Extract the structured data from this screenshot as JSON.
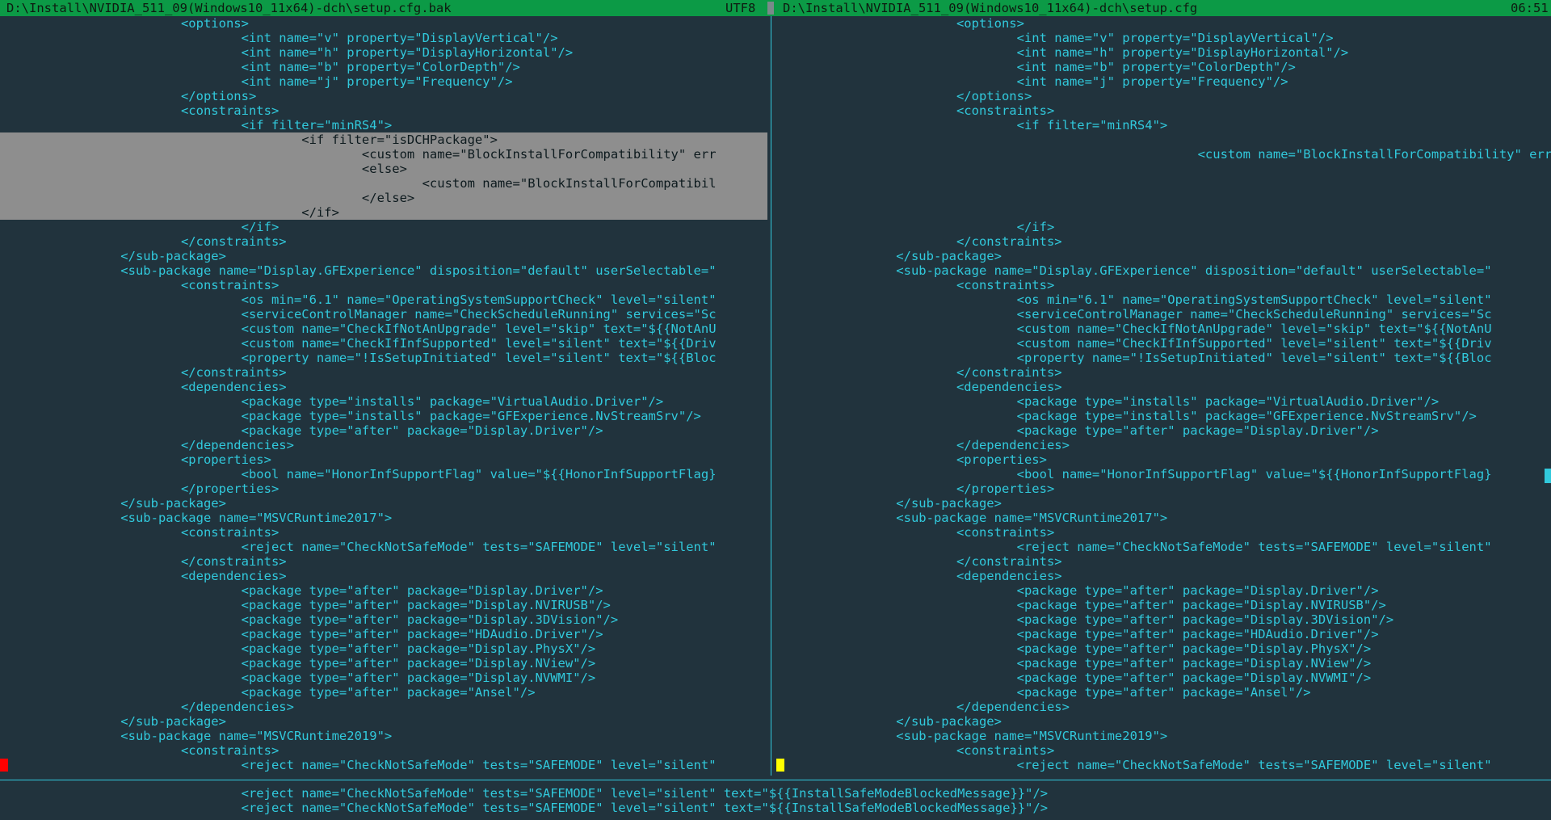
{
  "titlebar": {
    "left_file": "D:\\Install\\NVIDIA_511_09(Windows10_11x64)-dch\\setup.cfg.bak",
    "encoding": "UTF8",
    "right_file": "D:\\Install\\NVIDIA_511_09(Windows10_11x64)-dch\\setup.cfg",
    "clock": "06:51"
  },
  "left_lines": [
    "                        <options>",
    "                                <int name=\"v\" property=\"DisplayVertical\"/>",
    "                                <int name=\"h\" property=\"DisplayHorizontal\"/>",
    "                                <int name=\"b\" property=\"ColorDepth\"/>",
    "                                <int name=\"j\" property=\"Frequency\"/>",
    "                        </options>",
    "                        <constraints>",
    "                                <if filter=\"minRS4\">",
    "                                        <if filter=\"isDCHPackage\">",
    "                                                <custom name=\"BlockInstallForCompatibility\" err",
    "                                                <else>",
    "                                                        <custom name=\"BlockInstallForCompatibil",
    "                                                </else>",
    "                                        </if>",
    "                                </if>",
    "                        </constraints>",
    "                </sub-package>",
    "                <sub-package name=\"Display.GFExperience\" disposition=\"default\" userSelectable=\"",
    "                        <constraints>",
    "                                <os min=\"6.1\" name=\"OperatingSystemSupportCheck\" level=\"silent\"",
    "                                <serviceControlManager name=\"CheckScheduleRunning\" services=\"Sc",
    "                                <custom name=\"CheckIfNotAnUpgrade\" level=\"skip\" text=\"${{NotAnU",
    "                                <custom name=\"CheckIfInfSupported\" level=\"silent\" text=\"${{Driv",
    "                                <property name=\"!IsSetupInitiated\" level=\"silent\" text=\"${{Bloc",
    "                        </constraints>",
    "                        <dependencies>",
    "                                <package type=\"installs\" package=\"VirtualAudio.Driver\"/>",
    "                                <package type=\"installs\" package=\"GFExperience.NvStreamSrv\"/>",
    "                                <package type=\"after\" package=\"Display.Driver\"/>",
    "                        </dependencies>",
    "                        <properties>",
    "                                <bool name=\"HonorInfSupportFlag\" value=\"${{HonorInfSupportFlag}",
    "                        </properties>",
    "                </sub-package>",
    "                <sub-package name=\"MSVCRuntime2017\">",
    "                        <constraints>",
    "                                <reject name=\"CheckNotSafeMode\" tests=\"SAFEMODE\" level=\"silent\"",
    "                        </constraints>",
    "                        <dependencies>",
    "                                <package type=\"after\" package=\"Display.Driver\"/>",
    "                                <package type=\"after\" package=\"Display.NVIRUSB\"/>",
    "                                <package type=\"after\" package=\"Display.3DVision\"/>",
    "                                <package type=\"after\" package=\"HDAudio.Driver\"/>",
    "                                <package type=\"after\" package=\"Display.PhysX\"/>",
    "                                <package type=\"after\" package=\"Display.NView\"/>",
    "                                <package type=\"after\" package=\"Display.NVWMI\"/>",
    "                                <package type=\"after\" package=\"Ansel\"/>",
    "                        </dependencies>",
    "                </sub-package>",
    "                <sub-package name=\"MSVCRuntime2019\">",
    "                        <constraints>",
    "                                <reject name=\"CheckNotSafeMode\" tests=\"SAFEMODE\" level=\"silent\""
  ],
  "right_lines": [
    "                        <options>",
    "                                <int name=\"v\" property=\"DisplayVertical\"/>",
    "                                <int name=\"h\" property=\"DisplayHorizontal\"/>",
    "                                <int name=\"b\" property=\"ColorDepth\"/>",
    "                                <int name=\"j\" property=\"Frequency\"/>",
    "                        </options>",
    "                        <constraints>",
    "                                <if filter=\"minRS4\">",
    "",
    "                                                        <custom name=\"BlockInstallForCompatibility\" err",
    "",
    "",
    "",
    "",
    "                                </if>",
    "                        </constraints>",
    "                </sub-package>",
    "                <sub-package name=\"Display.GFExperience\" disposition=\"default\" userSelectable=\"",
    "                        <constraints>",
    "                                <os min=\"6.1\" name=\"OperatingSystemSupportCheck\" level=\"silent\"",
    "                                <serviceControlManager name=\"CheckScheduleRunning\" services=\"Sc",
    "                                <custom name=\"CheckIfNotAnUpgrade\" level=\"skip\" text=\"${{NotAnU",
    "                                <custom name=\"CheckIfInfSupported\" level=\"silent\" text=\"${{Driv",
    "                                <property name=\"!IsSetupInitiated\" level=\"silent\" text=\"${{Bloc",
    "                        </constraints>",
    "                        <dependencies>",
    "                                <package type=\"installs\" package=\"VirtualAudio.Driver\"/>",
    "                                <package type=\"installs\" package=\"GFExperience.NvStreamSrv\"/>",
    "                                <package type=\"after\" package=\"Display.Driver\"/>",
    "                        </dependencies>",
    "                        <properties>",
    "                                <bool name=\"HonorInfSupportFlag\" value=\"${{HonorInfSupportFlag}",
    "                        </properties>",
    "                </sub-package>",
    "                <sub-package name=\"MSVCRuntime2017\">",
    "                        <constraints>",
    "                                <reject name=\"CheckNotSafeMode\" tests=\"SAFEMODE\" level=\"silent\"",
    "                        </constraints>",
    "                        <dependencies>",
    "                                <package type=\"after\" package=\"Display.Driver\"/>",
    "                                <package type=\"after\" package=\"Display.NVIRUSB\"/>",
    "                                <package type=\"after\" package=\"Display.3DVision\"/>",
    "                                <package type=\"after\" package=\"HDAudio.Driver\"/>",
    "                                <package type=\"after\" package=\"Display.PhysX\"/>",
    "                                <package type=\"after\" package=\"Display.NView\"/>",
    "                                <package type=\"after\" package=\"Display.NVWMI\"/>",
    "                                <package type=\"after\" package=\"Ansel\"/>",
    "                        </dependencies>",
    "                </sub-package>",
    "                <sub-package name=\"MSVCRuntime2019\">",
    "                        <constraints>",
    "                                <reject name=\"CheckNotSafeMode\" tests=\"SAFEMODE\" level=\"silent\""
  ],
  "bottom_lines": [
    "                                <reject name=\"CheckNotSafeMode\" tests=\"SAFEMODE\" level=\"silent\" text=\"${{InstallSafeModeBlockedMessage}}\"/>",
    "                                <reject name=\"CheckNotSafeMode\" tests=\"SAFEMODE\" level=\"silent\" text=\"${{InstallSafeModeBlockedMessage}}\"/>"
  ],
  "left_highlight_full": [
    8,
    10,
    11,
    12,
    13
  ],
  "left_highlight_partial": [
    9
  ],
  "colors": {
    "background": "#21333d",
    "text": "#31c9dc",
    "titlebar": "#0c9a46",
    "highlight": "#8e8e8e",
    "left_marker": "#ff0000",
    "right_marker": "#ffff00"
  }
}
